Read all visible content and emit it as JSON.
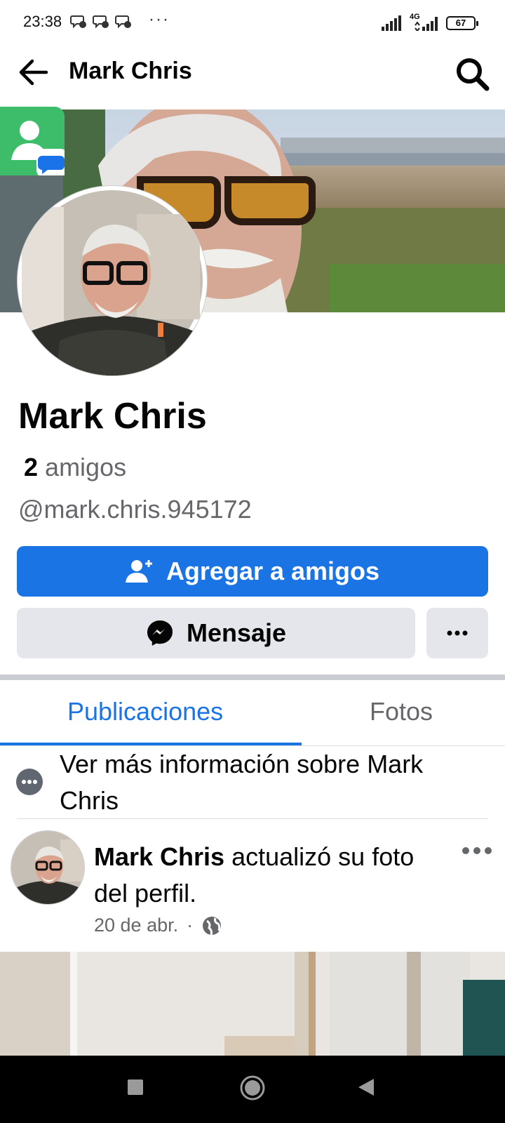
{
  "status_bar": {
    "time": "23:38",
    "more": "···",
    "network": "4G",
    "battery": "67"
  },
  "header": {
    "title": "Mark Chris"
  },
  "profile": {
    "name": "Mark Chris",
    "friends_count": "2",
    "friends_label": "amigos",
    "username": "@mark.chris.945172"
  },
  "actions": {
    "add_friend": "Agregar a amigos",
    "message": "Mensaje"
  },
  "tabs": [
    {
      "label": "Publicaciones",
      "active": true
    },
    {
      "label": "Fotos",
      "active": false
    }
  ],
  "info": {
    "text": "Ver más información sobre Mark Chris"
  },
  "post": {
    "author": "Mark Chris",
    "action": " actualizó su foto del perfil.",
    "date": "20 de abr.",
    "separator": "·"
  },
  "colors": {
    "accent": "#1b74e4",
    "secondary_button": "#e4e6eb",
    "muted_text": "#65676b"
  },
  "icons": [
    "back-arrow-icon",
    "search-icon",
    "add-friend-icon",
    "messenger-icon",
    "more-icon",
    "info-icon",
    "globe-icon",
    "nav-square-icon",
    "nav-home-icon",
    "nav-back-icon"
  ]
}
